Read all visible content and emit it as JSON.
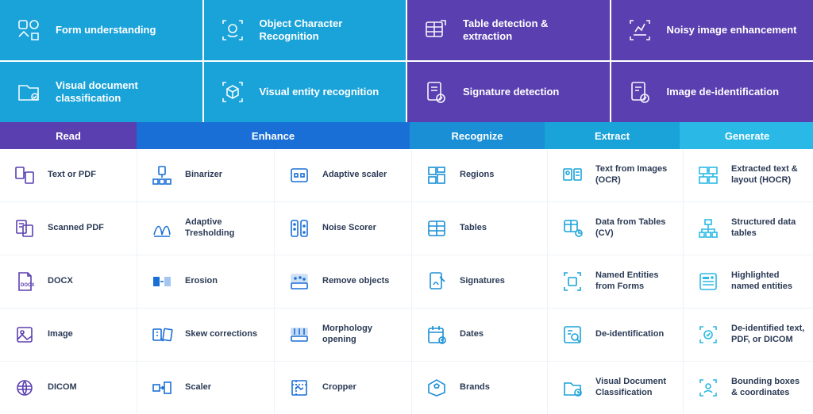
{
  "top_features": [
    {
      "label": "Form understanding",
      "color": "blue",
      "icon": "form-icon"
    },
    {
      "label": "Object Character Recognition",
      "color": "blue",
      "icon": "ocr-icon"
    },
    {
      "label": "Table detection & extraction",
      "color": "purp",
      "icon": "table-icon"
    },
    {
      "label": "Noisy image enhancement",
      "color": "purp",
      "icon": "enhance-icon"
    },
    {
      "label": "Visual document classification",
      "color": "blue",
      "icon": "classify-icon"
    },
    {
      "label": "Visual entity recognition",
      "color": "blue",
      "icon": "entity-icon"
    },
    {
      "label": "Signature detection",
      "color": "purp",
      "icon": "signature-icon"
    },
    {
      "label": "Image de-identification",
      "color": "purp",
      "icon": "deid-icon"
    }
  ],
  "categories": [
    {
      "name": "Read",
      "class": "cat-read"
    },
    {
      "name": "Enhance",
      "class": "cat-enhance"
    },
    {
      "name": "Recognize",
      "class": "cat-recognize"
    },
    {
      "name": "Extract",
      "class": "cat-extract"
    },
    {
      "name": "Generate",
      "class": "cat-generate"
    }
  ],
  "items": {
    "read": [
      "Text or PDF",
      "Scanned PDF",
      "DOCX",
      "Image",
      "DICOM"
    ],
    "enhance1": [
      "Binarizer",
      "Adaptive Tresholding",
      "Erosion",
      "Skew corrections",
      "Scaler"
    ],
    "enhance2": [
      "Adaptive scaler",
      "Noise Scorer",
      "Remove objects",
      "Morphology opening",
      "Cropper"
    ],
    "recognize": [
      "Regions",
      "Tables",
      "Signatures",
      "Dates",
      "Brands"
    ],
    "extract": [
      "Text from Images (OCR)",
      "Data from Tables (CV)",
      "Named Entities from Forms",
      "De-identification",
      "Visual Document Classification"
    ],
    "generate": [
      "Extracted text & layout (HOCR)",
      "Structured data tables",
      "Highlighted named entities",
      "De-identified text, PDF, or DICOM",
      "Bounding boxes & coordinates"
    ]
  },
  "icon_names": {
    "read": [
      "text-pdf-icon",
      "scanned-pdf-icon",
      "docx-icon",
      "image-icon",
      "dicom-icon"
    ],
    "enhance1": [
      "binarizer-icon",
      "adaptive-threshold-icon",
      "erosion-icon",
      "skew-icon",
      "scaler-icon"
    ],
    "enhance2": [
      "adaptive-scaler-icon",
      "noise-scorer-icon",
      "remove-objects-icon",
      "morphology-icon",
      "cropper-icon"
    ],
    "recognize": [
      "regions-icon",
      "tables-icon",
      "signatures-icon",
      "dates-icon",
      "brands-icon"
    ],
    "extract": [
      "ocr-icon",
      "cv-table-icon",
      "ner-icon",
      "deid-icon",
      "vdc-icon"
    ],
    "generate": [
      "hocr-icon",
      "structured-icon",
      "highlight-icon",
      "deid-output-icon",
      "bbox-icon"
    ]
  }
}
